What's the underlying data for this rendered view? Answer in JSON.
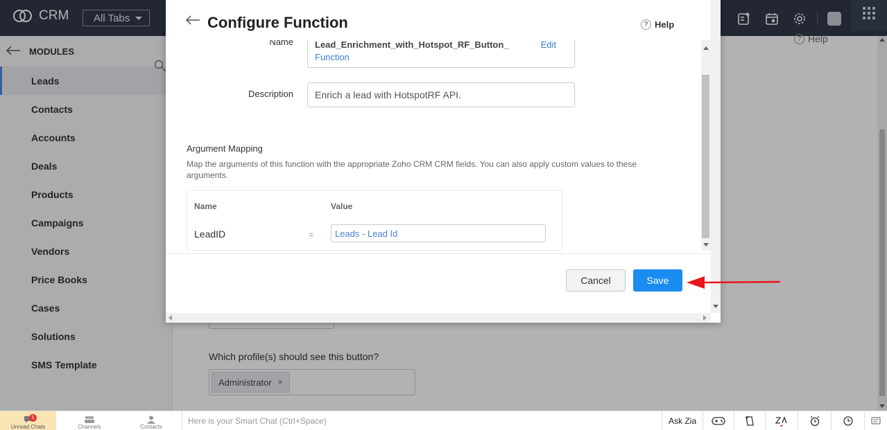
{
  "app": {
    "name": "CRM",
    "all_tabs": "All Tabs"
  },
  "sidebar": {
    "title": "MODULES",
    "items": [
      {
        "label": "Leads",
        "active": true
      },
      {
        "label": "Contacts"
      },
      {
        "label": "Accounts"
      },
      {
        "label": "Deals"
      },
      {
        "label": "Products"
      },
      {
        "label": "Campaigns"
      },
      {
        "label": "Vendors"
      },
      {
        "label": "Price Books"
      },
      {
        "label": "Cases"
      },
      {
        "label": "Solutions"
      },
      {
        "label": "SMS Template"
      }
    ]
  },
  "background": {
    "help": "Help",
    "profiles_label": "Which profile(s) should see this button?",
    "profile_chip": "Administrator",
    "chip_remove": "×"
  },
  "modal": {
    "title": "Configure Function",
    "help": "Help",
    "name_label": "Name",
    "name_value_line1": "Lead_Enrichment_with_Hotspot_RF_Button_",
    "name_value_line2": "Function",
    "edit": "Edit",
    "description_label": "Description",
    "description_value": "Enrich a lead with HotspotRF API.",
    "mapping_title": "Argument Mapping",
    "mapping_desc": "Map the arguments of this function with the appropriate Zoho CRM CRM fields. You can also apply custom values to these arguments.",
    "col_name": "Name",
    "col_value": "Value",
    "arg_name": "LeadID",
    "eq": "=",
    "arg_value": "Leads - Lead Id",
    "cancel": "Cancel",
    "save": "Save"
  },
  "bottom_bar": {
    "unread_chats": "Unread Chats",
    "unread_count": "1",
    "channels": "Channels",
    "contacts": "Contacts",
    "smart_chat_placeholder": "Here is your Smart Chat (Ctrl+Space)",
    "ask_zia": "Ask Zia"
  },
  "colors": {
    "topbar": "#313949",
    "primary": "#1a8cf0",
    "annotation": "#e8161b"
  }
}
